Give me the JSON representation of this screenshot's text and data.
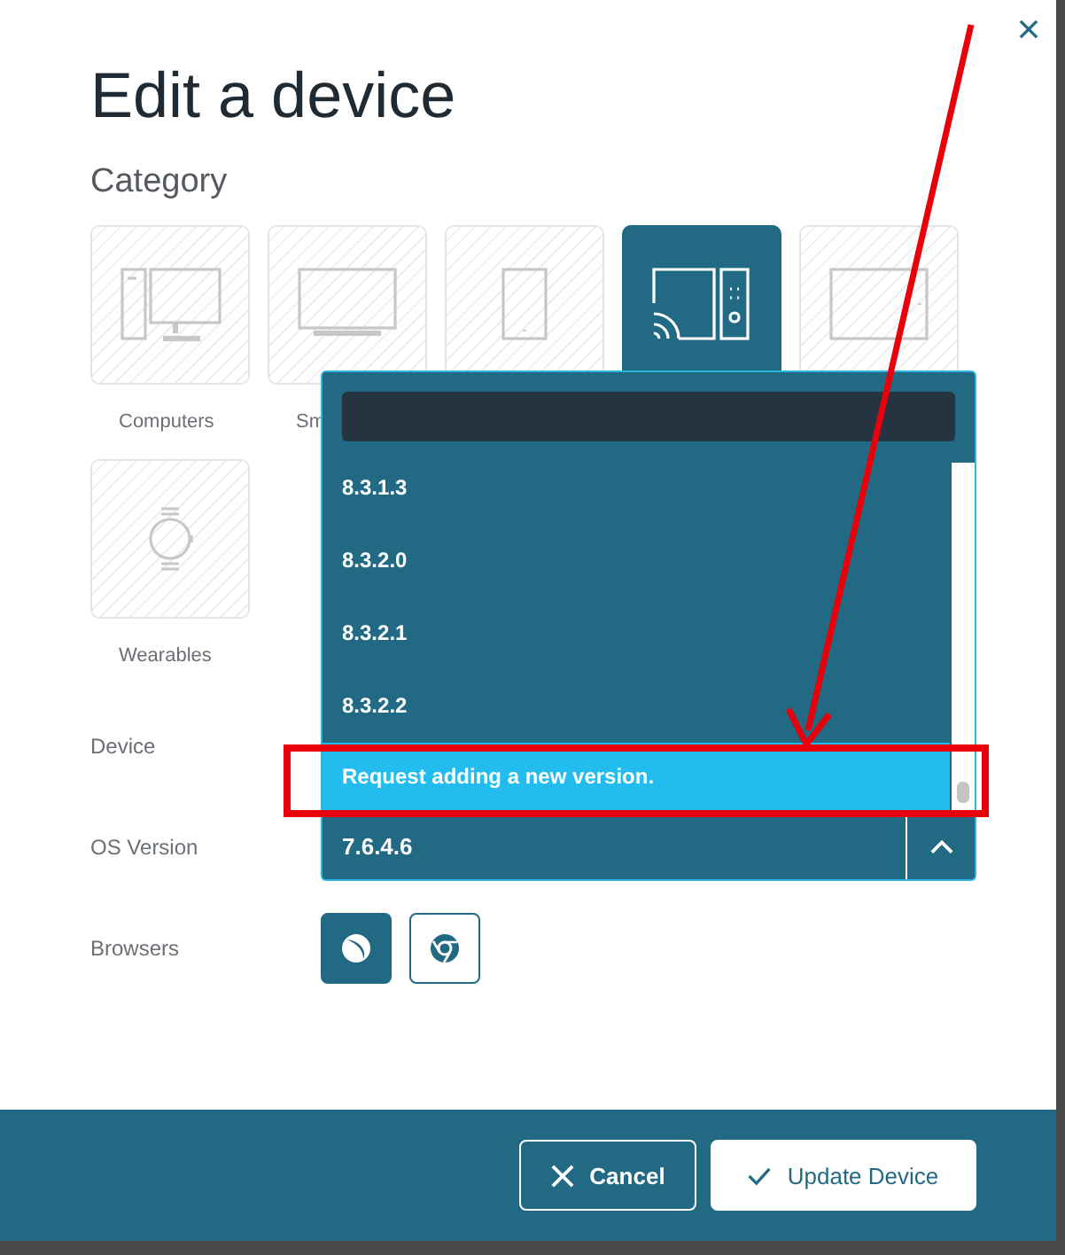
{
  "dialog": {
    "title": "Edit a device"
  },
  "category": {
    "label": "Category",
    "tiles": [
      {
        "kind": "computer",
        "label": "Computers",
        "selected": false
      },
      {
        "kind": "tv",
        "label": "Sm",
        "selected": false
      },
      {
        "kind": "tablet",
        "selected": false
      },
      {
        "kind": "streaming",
        "selected": true
      },
      {
        "kind": "large-tablet",
        "selected": false
      },
      {
        "kind": "watch",
        "label": "Wearables",
        "selected": false
      }
    ]
  },
  "form": {
    "device_label": "Device",
    "os_label": "OS Version",
    "os_value": "7.6.4.6",
    "browsers_label": "Browsers"
  },
  "os_dropdown": {
    "expanded": true,
    "options": [
      {
        "label": "8.3.1.3",
        "selected": false
      },
      {
        "label": "8.3.2.0",
        "selected": false
      },
      {
        "label": "8.3.2.1",
        "selected": false
      },
      {
        "label": "8.3.2.2",
        "selected": false
      },
      {
        "label": "Request adding a new version.",
        "selected": true
      }
    ]
  },
  "browsers": [
    {
      "kind": "safari",
      "selected": true
    },
    {
      "kind": "chrome",
      "selected": false
    }
  ],
  "footer": {
    "buttons": [
      {
        "kind": "cancel",
        "label": "Cancel"
      },
      {
        "kind": "confirm",
        "label": "Update Device"
      }
    ]
  }
}
